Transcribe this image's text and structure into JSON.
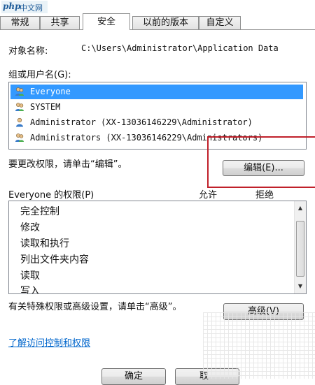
{
  "watermark": {
    "brand": "php",
    "site": "中文网"
  },
  "tabs": [
    {
      "label": "常规"
    },
    {
      "label": "共享"
    },
    {
      "label": "安全"
    },
    {
      "label": "以前的版本"
    },
    {
      "label": "自定义"
    }
  ],
  "object": {
    "label": "对象名称:",
    "value": "C:\\Users\\Administrator\\Application Data"
  },
  "groups": {
    "label": "组或用户名(G):",
    "items": [
      {
        "name": "Everyone",
        "icon": "users-group-icon",
        "selected": true
      },
      {
        "name": "SYSTEM",
        "icon": "users-group-icon",
        "selected": false
      },
      {
        "name": "Administrator (XX-13036146229\\Administrator)",
        "icon": "user-icon",
        "selected": false
      },
      {
        "name": "Administrators (XX-13036146229\\Administrators)",
        "icon": "users-group-icon",
        "selected": false
      }
    ]
  },
  "edit": {
    "hint": "要更改权限，请单击“编辑”。",
    "button": "编辑(E)..."
  },
  "permissions": {
    "title": "Everyone 的权限(P)",
    "allow": "允许",
    "deny": "拒绝",
    "items": [
      "完全控制",
      "修改",
      "读取和执行",
      "列出文件夹内容",
      "读取",
      "写入"
    ]
  },
  "advanced": {
    "hint": "有关特殊权限或高级设置，请单击“高级”。",
    "button": "高级(V)"
  },
  "learn_link": "了解访问控制和权限",
  "footer": {
    "ok": "确定",
    "cancel": "取"
  },
  "colors": {
    "selection": "#3399ff",
    "highlight_box": "#c0202a",
    "link": "#0066cc"
  }
}
